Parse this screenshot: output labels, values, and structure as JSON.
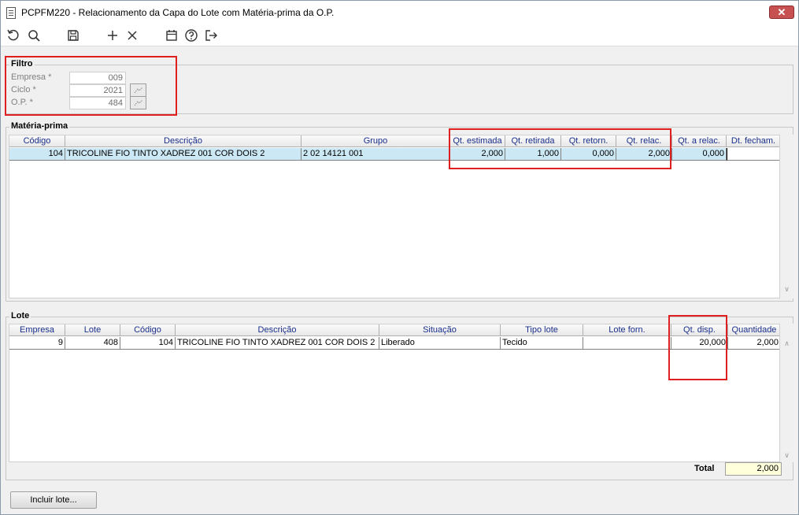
{
  "window": {
    "title": "PCPFM220 - Relacionamento da Capa do Lote com Matéria-prima da O.P.",
    "close_label": "✕"
  },
  "toolbar": {
    "buttons": [
      {
        "name": "refresh-icon"
      },
      {
        "name": "search-icon"
      },
      {
        "name": "save-icon"
      },
      {
        "name": "add-icon"
      },
      {
        "name": "delete-icon"
      },
      {
        "name": "calendar-icon"
      },
      {
        "name": "help-icon"
      },
      {
        "name": "exit-icon"
      }
    ]
  },
  "filtro": {
    "legend": "Filtro",
    "empresa_label": "Empresa *",
    "empresa_value": "009",
    "ciclo_label": "Ciclo *",
    "ciclo_value": "2021",
    "op_label": "O.P. *",
    "op_value": "484"
  },
  "materia_prima": {
    "legend": "Matéria-prima",
    "columns": [
      "Código",
      "Descrição",
      "Grupo",
      "Qt. estimada",
      "Qt. retirada",
      "Qt. retorn.",
      "Qt. relac.",
      "Qt. a relac.",
      "Dt. fecham."
    ],
    "rows": [
      [
        "104",
        "TRICOLINE FIO TINTO XADREZ 001 COR DOIS 2",
        "2 02 14121 001",
        "2,000",
        "1,000",
        "0,000",
        "2,000",
        "0,000",
        ""
      ]
    ]
  },
  "lote": {
    "legend": "Lote",
    "columns": [
      "Empresa",
      "Lote",
      "Código",
      "Descrição",
      "Situação",
      "Tipo lote",
      "Lote forn.",
      "Qt. disp.",
      "Quantidade"
    ],
    "rows": [
      [
        "9",
        "408",
        "104",
        "TRICOLINE FIO TINTO XADREZ 001 COR DOIS 2",
        "Liberado",
        "Tecido",
        "",
        "20,000",
        "2,000"
      ]
    ],
    "total_label": "Total",
    "total_value": "2,000"
  },
  "footer": {
    "incluir_lote_label": "Incluir lote..."
  },
  "colors": {
    "highlight": "#e02020",
    "header_text": "#1a2f8a",
    "selected_row": "#cce8f4",
    "total_bg": "#ffffdc"
  }
}
